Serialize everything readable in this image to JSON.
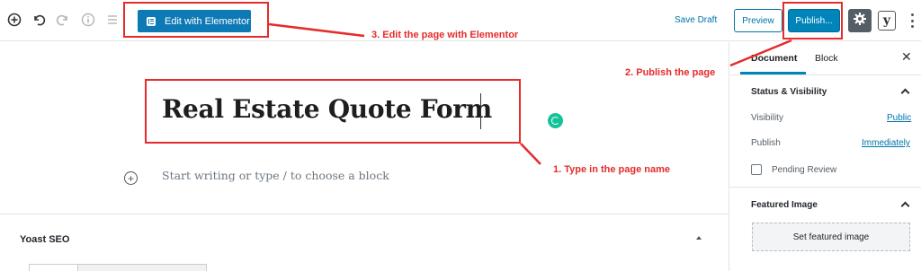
{
  "toolbar": {
    "elementor_label": "Edit with Elementor",
    "save_draft": "Save Draft",
    "preview": "Preview",
    "publish": "Publish...",
    "yoast_letter": "y"
  },
  "editor": {
    "title": "Real Estate Quote Form",
    "placeholder": "Start writing or type / to choose a block"
  },
  "yoast": {
    "title": "Yoast SEO"
  },
  "sidebar": {
    "tabs": [
      "Document",
      "Block"
    ],
    "active_tab": "Document",
    "status_visibility": {
      "title": "Status & Visibility",
      "visibility_label": "Visibility",
      "visibility_value": "Public",
      "publish_label": "Publish",
      "publish_value": "Immediately",
      "pending_review": "Pending Review"
    },
    "featured_image": {
      "title": "Featured Image",
      "button": "Set featured image"
    }
  },
  "annotations": {
    "step1": "1. Type in the page name",
    "step2": "2. Publish the page",
    "step3": "3. Edit the page with Elementor"
  },
  "colors": {
    "accent": "#0085ba",
    "elementor_blue": "#0e7ab5",
    "annotation_red": "#e52b2b",
    "grammarly_green": "#15c39a"
  }
}
